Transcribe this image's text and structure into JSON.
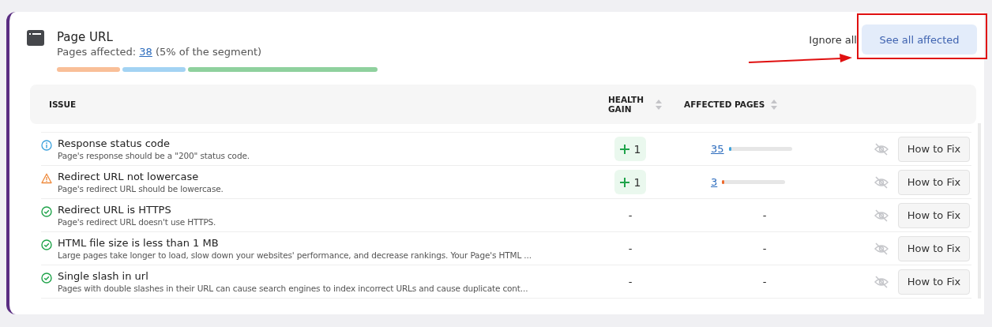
{
  "panel": {
    "title": "Page URL",
    "pages_label": "Pages affected:",
    "pages_count": "38",
    "pages_note": "(5% of the segment)",
    "segments": [
      {
        "color": "#f9bf98"
      },
      {
        "color": "#a3d3f3"
      },
      {
        "color": "#8fd19e"
      }
    ],
    "actions": [
      {
        "label": "Ignore all",
        "kind": "link"
      },
      {
        "label": "See all affected",
        "kind": "primary"
      }
    ]
  },
  "table": {
    "columns": [
      {
        "label": "ISSUE",
        "sortable": false
      },
      {
        "label": "HEALTH GAIN",
        "sortable": true
      },
      {
        "label": "AFFECTED PAGES",
        "sortable": true
      }
    ],
    "rows": [
      {
        "kind": "info",
        "title": "Response status code",
        "description": "Page's response should be a \"200\" status code.",
        "health_gain": {
          "kind": "gain",
          "text": "1"
        },
        "affected": {
          "kind": "count",
          "text": "35",
          "level": 0.04
        },
        "action": "How to Fix"
      },
      {
        "kind": "warning",
        "title": "Redirect URL not lowercase",
        "description": "Page's redirect URL should be lowercase.",
        "health_gain": {
          "kind": "gain",
          "text": "1"
        },
        "affected": {
          "kind": "count",
          "text": "3",
          "level": 0.02
        },
        "action": "How to Fix"
      },
      {
        "kind": "ok",
        "title": "Redirect URL is HTTPS",
        "description": "Page's redirect URL doesn't use HTTPS.",
        "health_gain": {
          "kind": "none",
          "text": "-"
        },
        "affected": {
          "kind": "none",
          "text": "-"
        },
        "action": "How to Fix"
      },
      {
        "kind": "ok",
        "title": "HTML file size is less than 1 MB",
        "description": "Large pages take longer to load, slow down your websites' performance, and decrease rankings. Your Page's HTML ...",
        "health_gain": {
          "kind": "none",
          "text": "-"
        },
        "affected": {
          "kind": "none",
          "text": "-"
        },
        "action": "How to Fix"
      },
      {
        "kind": "ok",
        "title": "Single slash in url",
        "description": "Pages with double slashes in their URL can cause search engines to index incorrect URLs and cause duplicate cont...",
        "health_gain": {
          "kind": "none",
          "text": "-"
        },
        "affected": {
          "kind": "none",
          "text": "-"
        },
        "action": "How to Fix"
      }
    ]
  }
}
